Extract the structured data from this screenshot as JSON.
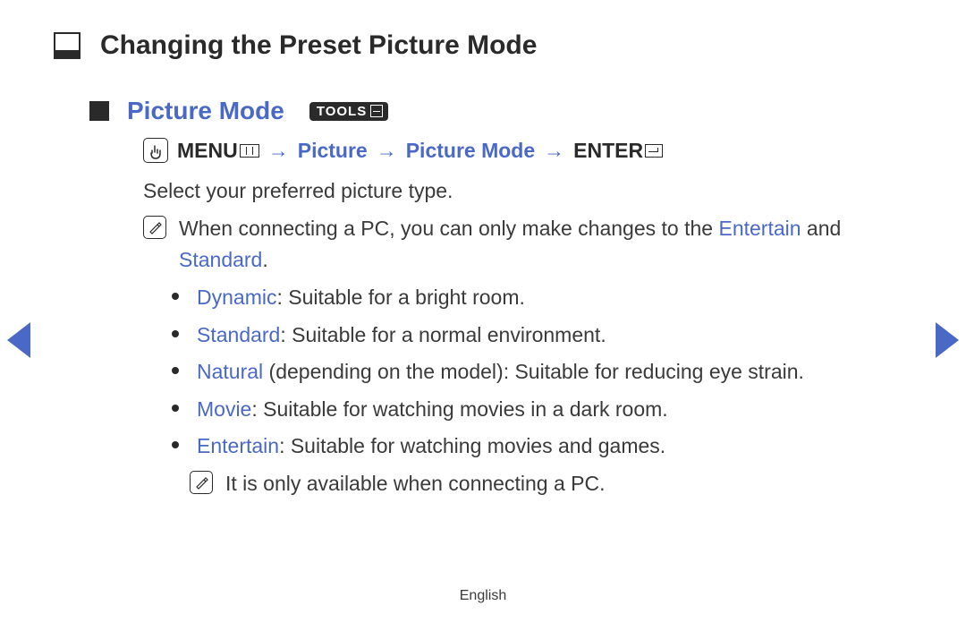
{
  "chapter": {
    "title": "Changing the Preset Picture Mode"
  },
  "section": {
    "title": "Picture Mode",
    "tools_label": "TOOLS"
  },
  "nav": {
    "menu": "MENU",
    "arrow": "→",
    "path1": "Picture",
    "path2": "Picture Mode",
    "enter": "ENTER"
  },
  "body": {
    "intro": "Select your preferred picture type.",
    "pc_note_pre": "When connecting a PC, you can only make changes to the ",
    "pc_note_kw1": "Entertain",
    "pc_note_mid": " and ",
    "pc_note_kw2": "Standard",
    "pc_note_post": "."
  },
  "modes": [
    {
      "name": "Dynamic",
      "desc": ": Suitable for a bright room."
    },
    {
      "name": "Standard",
      "desc": ": Suitable for a normal environment."
    },
    {
      "name": "Natural",
      "extra": " (depending on the model)",
      "desc": ": Suitable for reducing eye strain."
    },
    {
      "name": "Movie",
      "desc": ": Suitable for watching movies in a dark room."
    },
    {
      "name": "Entertain",
      "desc": ": Suitable for watching movies and games."
    }
  ],
  "sub_note": "It is only available when connecting a PC.",
  "footer": {
    "language": "English"
  }
}
